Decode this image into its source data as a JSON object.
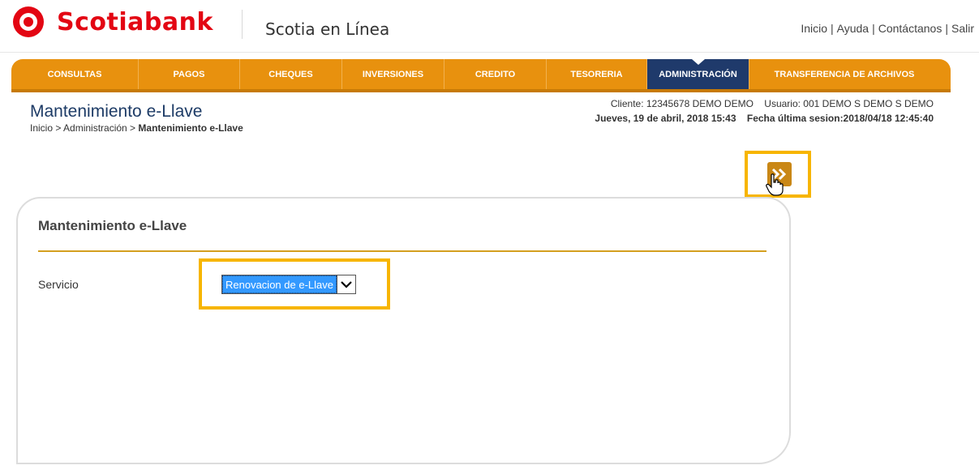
{
  "brand": {
    "name": "Scotiabank",
    "product": "Scotia en Línea",
    "color": "#e30613"
  },
  "top_links": [
    "Inicio",
    "Ayuda",
    "Contáctanos",
    "Salir"
  ],
  "nav": {
    "items": [
      "CONSULTAS",
      "PAGOS",
      "CHEQUES",
      "INVERSIONES",
      "CREDITO",
      "TESORERIA",
      "ADMINISTRACIÓN",
      "TRANSFERENCIA DE ARCHIVOS"
    ],
    "active": "ADMINISTRACIÓN",
    "color": "#e8910e",
    "active_color": "#1f3a6b"
  },
  "page": {
    "title": "Mantenimiento e-Llave",
    "breadcrumb_prefix": "Inicio > Administración > ",
    "breadcrumb_current": "Mantenimiento e-Llave"
  },
  "session": {
    "client_label": "Cliente: 12345678  DEMO DEMO",
    "user_label": "Usuario: 001 DEMO S DEMO S DEMO",
    "date_label": "Jueves, 19 de abril, 2018 15:43",
    "last_session_label": "Fecha última sesion:2018/04/18 12:45:40"
  },
  "panel": {
    "title": "Mantenimiento e-Llave",
    "field_label": "Servicio",
    "select_value": "Renovacion de e-Llave"
  },
  "icons": {
    "next": "double-chevron-right-icon",
    "cursor": "hand-pointer-icon",
    "dropdown": "chevron-down-icon"
  },
  "highlight_color": "#f7b500"
}
